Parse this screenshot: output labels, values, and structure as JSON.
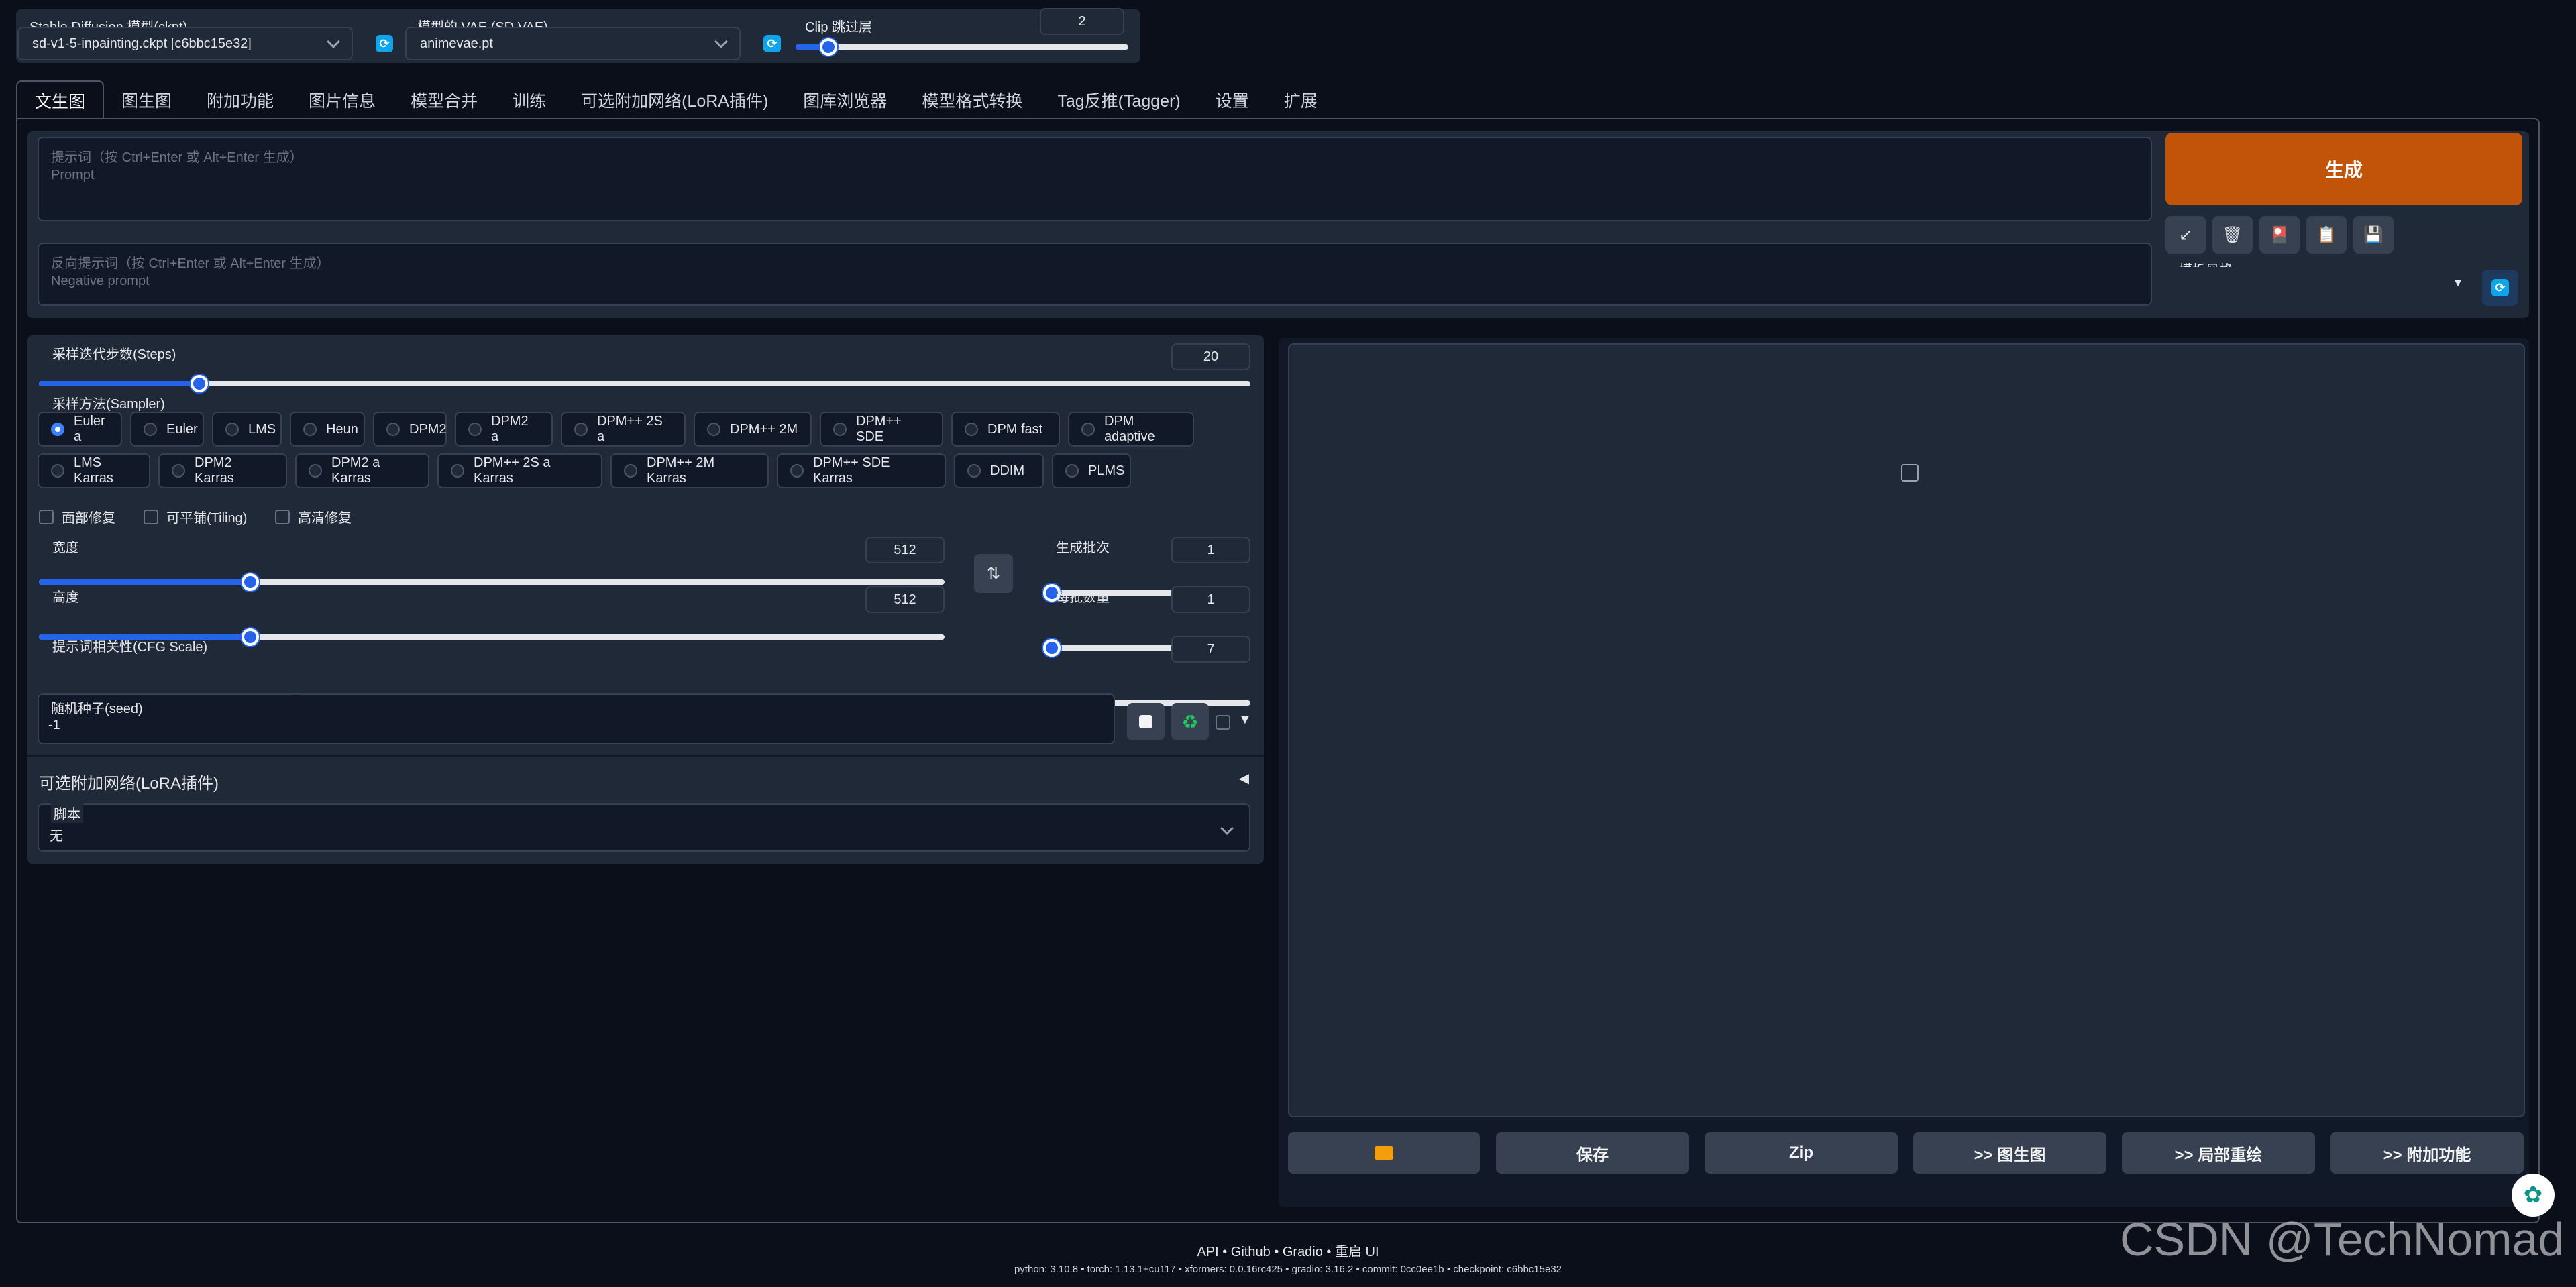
{
  "top": {
    "checkpoint_label": "Stable Diffusion 模型(ckpt)",
    "checkpoint_value": "sd-v1-5-inpainting.ckpt [c6bbc15e32]",
    "vae_label": "模型的 VAE (SD VAE)",
    "vae_value": "animevae.pt",
    "clip_label": "Clip 跳过层",
    "clip_value": "2",
    "clip_level": 0.09
  },
  "tabs": [
    "文生图",
    "图生图",
    "附加功能",
    "图片信息",
    "模型合并",
    "训练",
    "可选附加网络(LoRA插件)",
    "图库浏览器",
    "模型格式转换",
    "Tag反推(Tagger)",
    "设置",
    "扩展"
  ],
  "prompt": {
    "placeholder_line1": "提示词（按 Ctrl+Enter 或 Alt+Enter 生成）",
    "placeholder_line2": "Prompt",
    "neg_line1": "反向提示词（按 Ctrl+Enter 或 Alt+Enter 生成）",
    "neg_line2": "Negative prompt"
  },
  "generate_label": "生成",
  "tool_icons": [
    "arrow-icon",
    "trash-icon",
    "style-icon",
    "clipboard-icon",
    "save-style-icon"
  ],
  "style_label": "模板风格",
  "steps": {
    "label": "采样迭代步数(Steps)",
    "value": "20",
    "level": 0.13
  },
  "sampler": {
    "label": "采样方法(Sampler)",
    "row1": [
      "Euler a",
      "Euler",
      "LMS",
      "Heun",
      "DPM2",
      "DPM2 a",
      "DPM++ 2S a",
      "DPM++ 2M",
      "DPM++ SDE",
      "DPM fast",
      "DPM adaptive"
    ],
    "row2": [
      "LMS Karras",
      "DPM2 Karras",
      "DPM2 a Karras",
      "DPM++ 2S a Karras",
      "DPM++ 2M Karras",
      "DPM++ SDE Karras",
      "DDIM",
      "PLMS"
    ],
    "selected": "Euler a"
  },
  "checks": [
    "面部修复",
    "可平铺(Tiling)",
    "高清修复"
  ],
  "width": {
    "label": "宽度",
    "value": "512",
    "level": 0.23
  },
  "height": {
    "label": "高度",
    "value": "512",
    "level": 0.23
  },
  "batch_count": {
    "label": "生成批次",
    "value": "1",
    "level": 0.0
  },
  "batch_size": {
    "label": "每批数量",
    "value": "1",
    "level": 0.0
  },
  "cfg": {
    "label": "提示词相关性(CFG Scale)",
    "value": "7",
    "level": 0.21
  },
  "seed": {
    "label": "随机种子(seed)",
    "value": "-1"
  },
  "lora_label": "可选附加网络(LoRA插件)",
  "script": {
    "label": "脚本",
    "value": "无"
  },
  "output_buttons": [
    "保存",
    "Zip",
    ">> 图生图",
    ">> 局部重绘",
    ">> 附加功能"
  ],
  "footer": {
    "links": "API  •  Github  •  Gradio  •  重启 UI",
    "versions": "python: 3.10.8  •  torch: 1.13.1+cu117  •  xformers: 0.0.16rc425  •  gradio: 3.16.2  •  commit: 0cc0ee1b  •  checkpoint: c6bbc15e32"
  },
  "watermark": "CSDN @TechNomad"
}
